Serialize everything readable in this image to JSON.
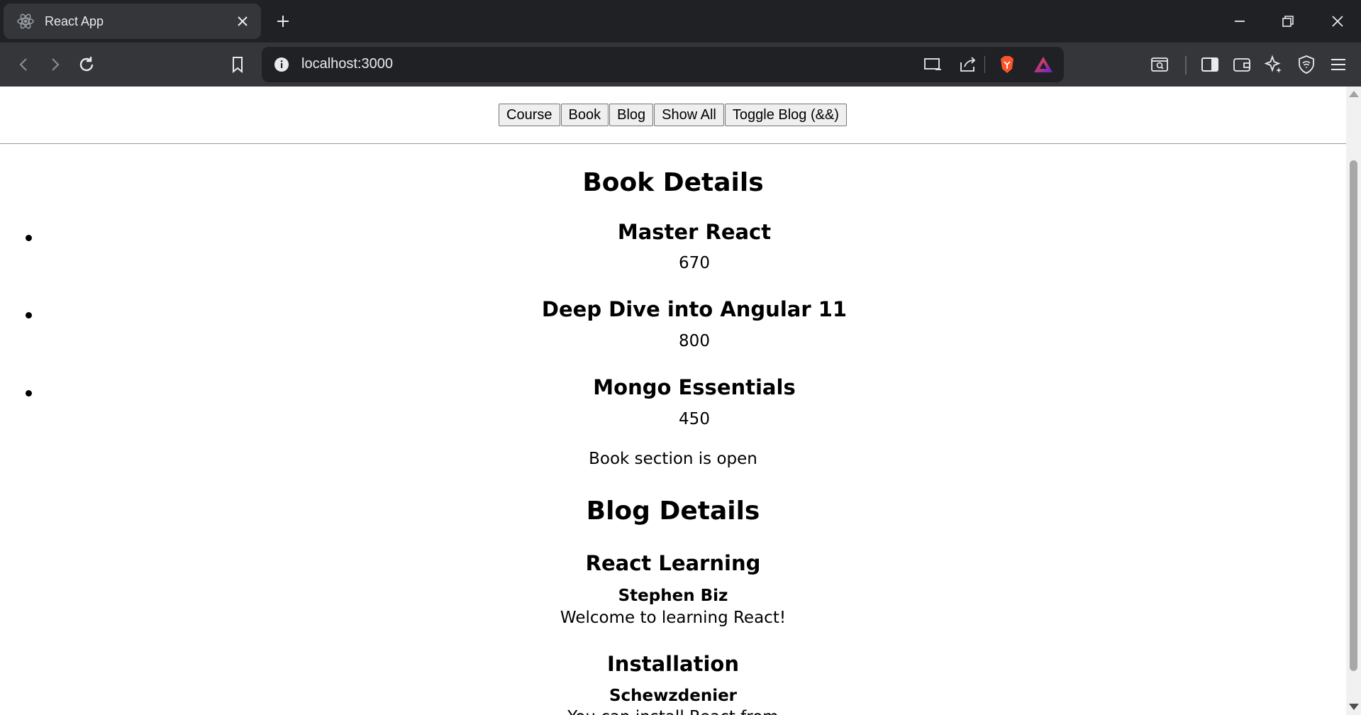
{
  "browser": {
    "tab_title": "React App",
    "url": "localhost:3000"
  },
  "nav": {
    "buttons": [
      "Course",
      "Book",
      "Blog",
      "Show All",
      "Toggle Blog (&&)"
    ]
  },
  "book_section": {
    "heading": "Book Details",
    "books": [
      {
        "name": "Master React",
        "price": "670"
      },
      {
        "name": "Deep Dive into Angular 11",
        "price": "800"
      },
      {
        "name": "Mongo Essentials",
        "price": "450"
      }
    ],
    "status": "Book section is open"
  },
  "blog_section": {
    "heading": "Blog Details",
    "posts": [
      {
        "title": "React Learning",
        "author": "Stephen Biz",
        "text": "Welcome to learning React!"
      },
      {
        "title": "Installation",
        "author": "Schewzdenier",
        "text": "You can install React from"
      }
    ]
  },
  "colors": {
    "chrome_dark": "#202124",
    "chrome_toolbar": "#35363a",
    "brave_orange": "#fb542b"
  }
}
